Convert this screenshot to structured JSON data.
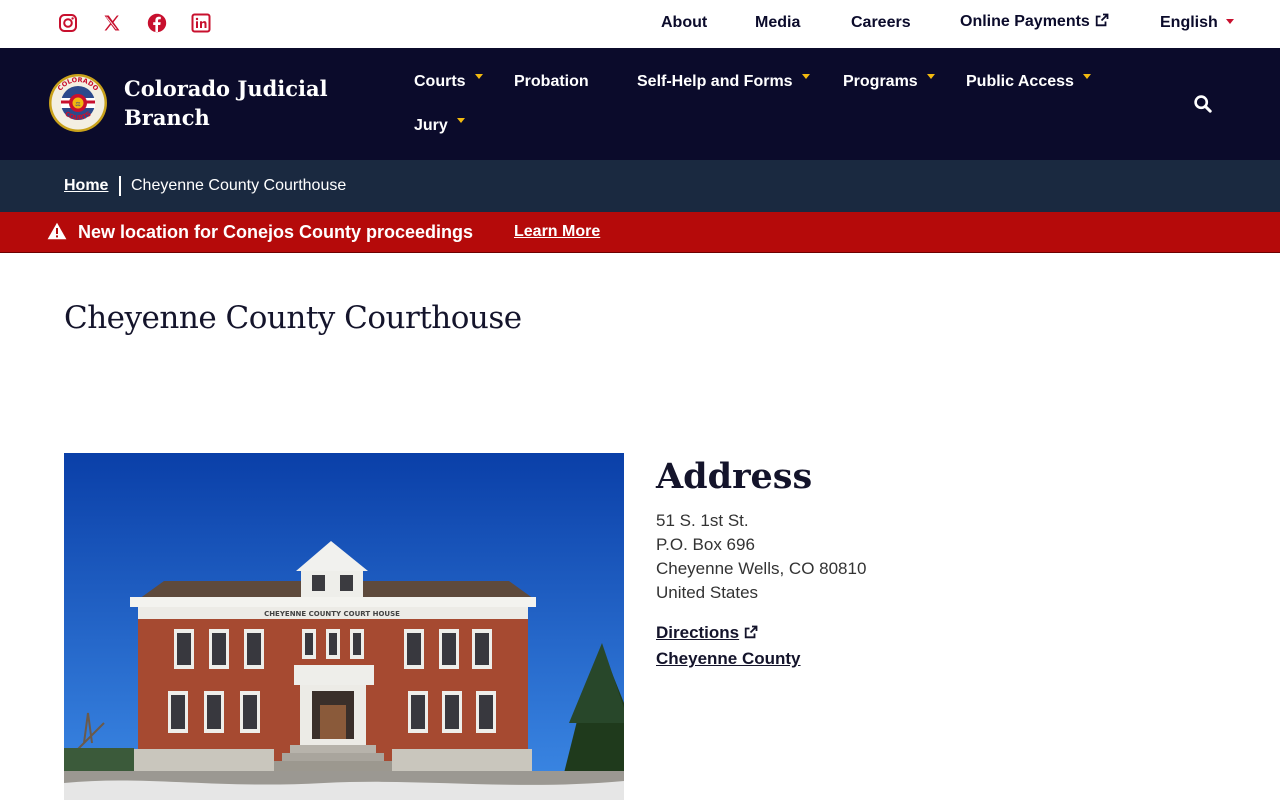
{
  "utility": {
    "links": [
      "About",
      "Media",
      "Careers",
      "Online Payments"
    ],
    "language": "English"
  },
  "header": {
    "site_name": "Colorado Judicial Branch",
    "nav": [
      "Courts",
      "Probation",
      "Self-Help and Forms",
      "Programs",
      "Public Access",
      "Jury"
    ]
  },
  "breadcrumb": {
    "home": "Home",
    "current": "Cheyenne County Courthouse"
  },
  "alert": {
    "text": "New location for Conejos County proceedings",
    "link": "Learn More"
  },
  "page": {
    "title": "Cheyenne County Courthouse",
    "photo_sign": "CHEYENNE COUNTY COURT HOUSE"
  },
  "address": {
    "heading": "Address",
    "lines": [
      "51 S. 1st St.",
      "P.O. Box 696",
      "Cheyenne Wells, CO 80810",
      "United States"
    ],
    "directions": "Directions",
    "county": "Cheyenne County"
  },
  "colors": {
    "navy": "#0b0b2b",
    "breadcrumb_bg": "#1a2940",
    "alert_red": "#b50a0a",
    "accent_gold": "#f2b90f",
    "social_red": "#c8102e"
  }
}
